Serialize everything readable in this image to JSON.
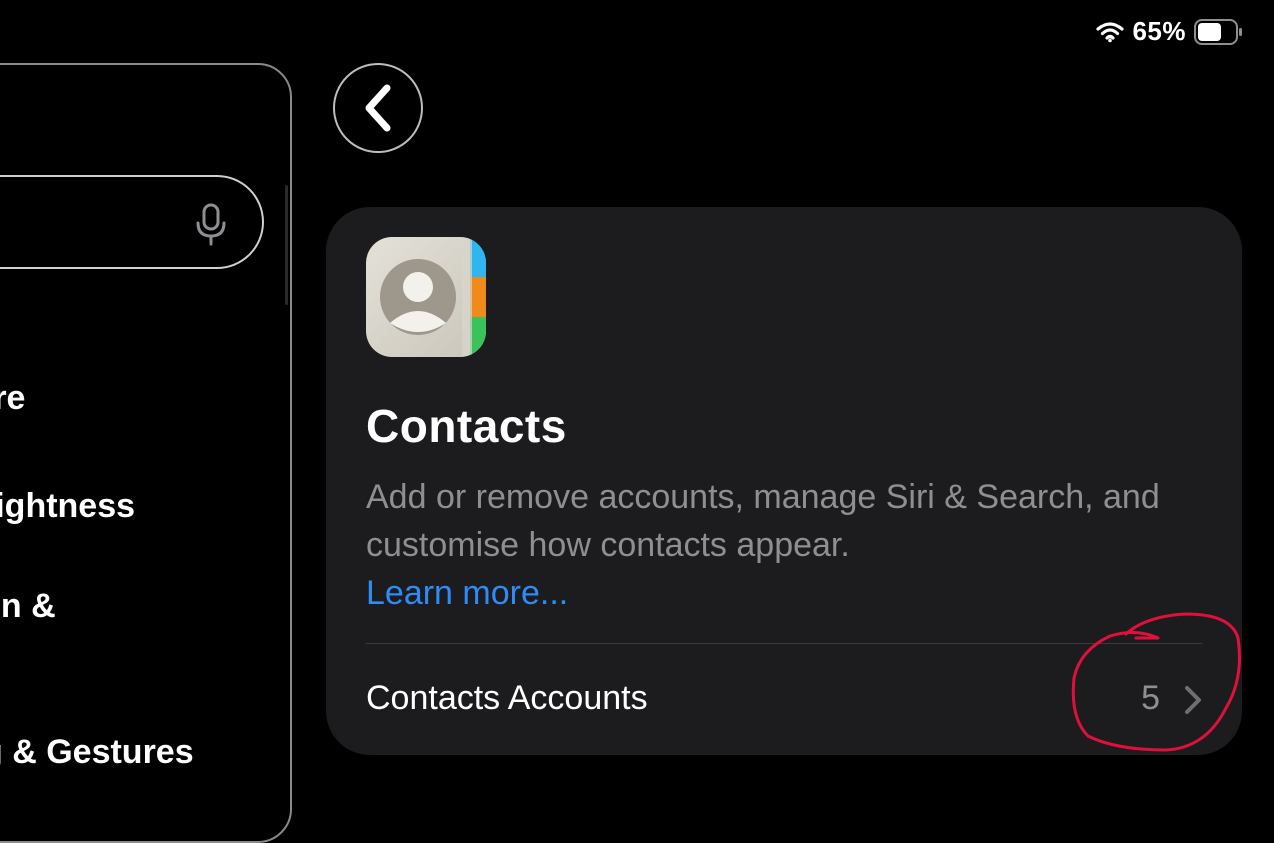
{
  "status_bar": {
    "wifi_icon": "wifi-icon",
    "battery_percent": "65%",
    "battery_level": 0.65
  },
  "sidebar": {
    "search_mic_icon": "microphone-icon",
    "items": [
      {
        "label": "tre"
      },
      {
        "label": "rightness"
      },
      {
        "label": "en &"
      },
      {
        "label": "g & Gestures"
      }
    ]
  },
  "nav": {
    "back_icon": "chevron-left-icon"
  },
  "card": {
    "icon": "contacts-app-icon",
    "title": "Contacts",
    "description": "Add or remove accounts, manage Siri & Search, and customise how contacts appear.",
    "learn_more": "Learn more...",
    "rows": [
      {
        "label": "Contacts Accounts",
        "value": "5",
        "icon": "chevron-right-icon"
      }
    ]
  },
  "colors": {
    "background": "#000000",
    "card": "#1c1c1e",
    "link": "#2f8bf5",
    "secondary_text": "#8e8e93",
    "annotation": "#e0103c"
  }
}
